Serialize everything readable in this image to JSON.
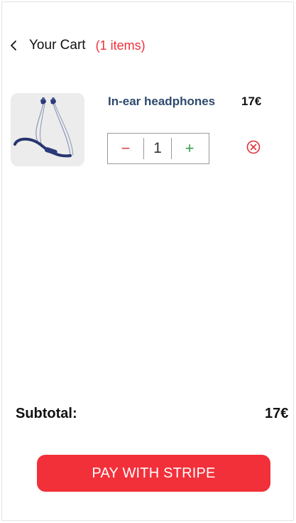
{
  "header": {
    "back_icon": "chevron-left-icon",
    "title": "Your Cart",
    "item_count": "(1 items)"
  },
  "cart": {
    "items": [
      {
        "name": "In-ear headphones",
        "price": "17€",
        "quantity": "1",
        "image_icon": "headphones-image",
        "decrement_label": "−",
        "increment_label": "+",
        "remove_icon": "remove-circle-x-icon"
      }
    ]
  },
  "summary": {
    "subtotal_label": "Subtotal:",
    "subtotal_value": "17€"
  },
  "checkout": {
    "pay_label": "PAY WITH STRIPE"
  },
  "colors": {
    "accent": "#f2303a",
    "product_name": "#2e4a6d",
    "plus": "#3aa04a",
    "minus": "#e04040"
  }
}
